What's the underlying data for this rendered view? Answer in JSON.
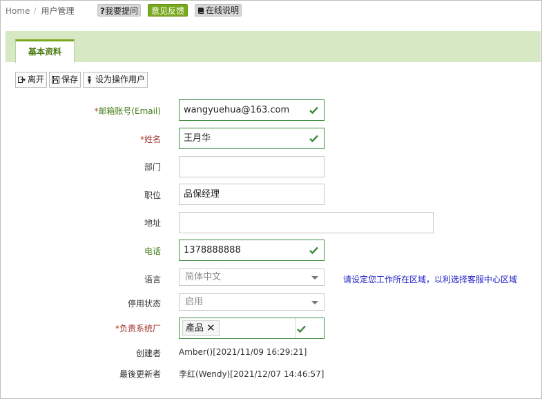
{
  "breadcrumb": {
    "home": "Home",
    "current": "用户管理"
  },
  "top_buttons": {
    "ask": "我要提问",
    "ask_prefix": "?",
    "feedback": "意见反馈",
    "manual": "在线说明"
  },
  "tab": {
    "label": "基本资料"
  },
  "toolbar": {
    "leave": "离开",
    "save": "保存",
    "set_operator": "设为操作用户"
  },
  "form": {
    "email": {
      "label": "邮箱账号(Email)",
      "value": "wangyuehua@163.com",
      "required": true
    },
    "name": {
      "label": "姓名",
      "value": "王月华",
      "required": true
    },
    "department": {
      "label": "部门",
      "value": ""
    },
    "position": {
      "label": "职位",
      "value": "品保经理"
    },
    "address": {
      "label": "地址",
      "value": ""
    },
    "phone": {
      "label": "电话",
      "value": "1378888888"
    },
    "language": {
      "label": "语言",
      "selected": "简体中文",
      "hint": "请设定您工作所在区域，以利选择客服中心区域"
    },
    "status": {
      "label": "停用状态",
      "selected": "启用"
    },
    "vendor": {
      "label": "负责系统厂",
      "tag": "產品",
      "required": true
    },
    "creator": {
      "label": "创建者",
      "value": "Amber()[2021/11/09 16:29:21]"
    },
    "updater": {
      "label": "最後更新者",
      "value": "李红(Wendy)[2021/12/07 14:46:57]"
    }
  },
  "colors": {
    "accent": "#7aa81f",
    "band": "#d6e8c4",
    "valid": "#3c8a3c",
    "hint": "#2020c8"
  },
  "icons": [
    "exit-icon",
    "save-icon",
    "user-icon",
    "book-icon",
    "checkmark-icon",
    "remove-icon",
    "dropdown-caret-icon"
  ]
}
